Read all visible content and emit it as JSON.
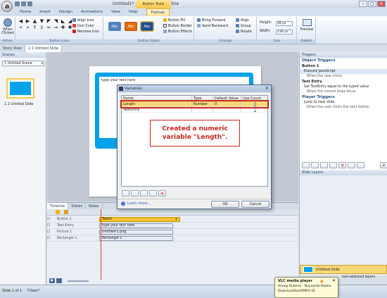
{
  "app": {
    "orb_letter": "a",
    "doc_title": "Untitled1* - Articulate Storyline",
    "context_tab_group": "Button Tools",
    "window_controls": [
      "–",
      "□",
      "✕"
    ]
  },
  "tabs": [
    "Home",
    "Insert",
    "Design",
    "Animations",
    "View",
    "Help",
    "Format"
  ],
  "active_tab": "Format",
  "ribbon": {
    "action": {
      "label_line1": "When",
      "label_line2": "Clicked",
      "group": "Action"
    },
    "button_icons": {
      "group": "Button Icons",
      "align_icon": "Align Icon",
      "icon_color": "Icon Color",
      "remove_icon": "Remove Icon"
    },
    "button_styles": {
      "group": "Button Styles",
      "style_labels": [
        "Abc",
        "Abc",
        "Abc"
      ],
      "fill": "Button Fill",
      "border": "Button Border",
      "effects": "Button Effects"
    },
    "arrange": {
      "group": "Arrange",
      "bring_forward": "Bring Forward",
      "send_backward": "Send Backward",
      "align": "Align",
      "group_btn": "Group",
      "rotate": "Rotate"
    },
    "size": {
      "group": "Size",
      "height_label": "Height:",
      "height_value": "48 px",
      "width_label": "Width:",
      "width_value": "136 px"
    },
    "publish": {
      "group": "Publish",
      "preview": "Preview"
    },
    "colors": {
      "style1": "#4f81bd",
      "style2": "#e36c0a",
      "style3": "#1f4e8c"
    }
  },
  "view_tabs": [
    "Story View",
    "1.1 Untitled Slide"
  ],
  "scenes": {
    "title": "Scenes",
    "selected_scene": "1 Untitled Scene",
    "slide_label": "1.1 Untitled Slide"
  },
  "stage": {
    "placeholder_text": "type your text here"
  },
  "dialog": {
    "title": "Variables",
    "columns": [
      "Name",
      "Type",
      "Default Value",
      "Use Count"
    ],
    "rows": [
      {
        "name": "Length",
        "type": "Number",
        "default": "0",
        "count": "0"
      },
      {
        "name": "TextEntry",
        "type": "",
        "default": "",
        "count": "1"
      }
    ],
    "callout": "Created a numeric variable \"Length\".",
    "learn_more": "Learn more...",
    "ok": "OK",
    "cancel": "Cancel"
  },
  "timeline": {
    "tabs": [
      "Timeline",
      "States",
      "Notes"
    ],
    "layers": [
      "Button 1",
      "Text Entry",
      "Picture 1",
      "Rectangle 1"
    ],
    "bars": [
      "Tweet",
      "type your text here",
      "Untitled-1.png",
      "Rectangle 1"
    ]
  },
  "triggers": {
    "title": "Triggers",
    "object_triggers": "Object Triggers",
    "button1": "Button 1",
    "b1_action": "Execute JavaScript",
    "b1_when": "When the user clicks",
    "text_entry": "Text Entry",
    "te_action": "Set TextEntry equal to the typed value",
    "te_when": "When the control loses focus",
    "player_triggers": "Player Triggers",
    "pt_action": "Jump to next slide",
    "pt_when": "When the user clicks the next button"
  },
  "slide_layers": {
    "title": "Slide Layers",
    "base_layer": "Untitled Slide",
    "dim_option": "non-selected layers"
  },
  "status": {
    "slide_count": "Slide 1 of 1",
    "theme": "\"Clean\""
  },
  "vlc": {
    "title": "VLC media player",
    "line1": "Anoop Rubens - Nuvvente Naaku",
    "line2": "DownloadSouthMP3.SE"
  }
}
